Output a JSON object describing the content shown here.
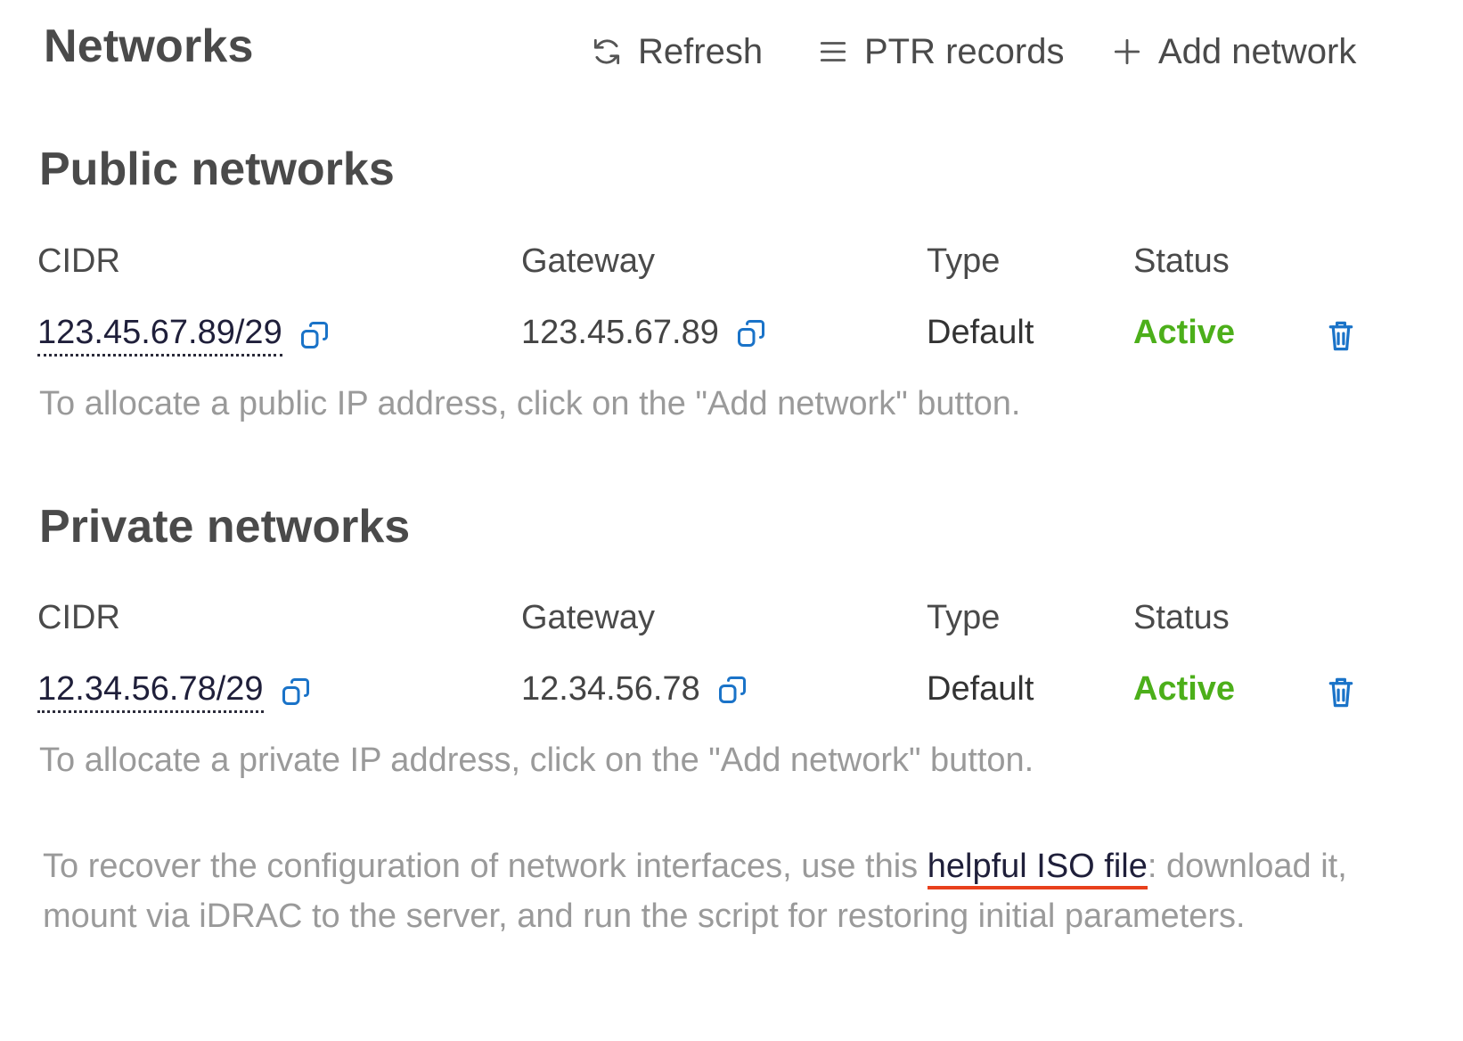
{
  "header": {
    "title": "Networks",
    "refresh_label": "Refresh",
    "ptr_label": "PTR records",
    "add_label": "Add network"
  },
  "columns": {
    "cidr": "CIDR",
    "gateway": "Gateway",
    "type": "Type",
    "status": "Status"
  },
  "public": {
    "title": "Public networks",
    "row": {
      "cidr": "123.45.67.89/29",
      "gateway": "123.45.67.89",
      "type": "Default",
      "status": "Active"
    },
    "hint": "To allocate a public IP address, click on the \"Add network\" button."
  },
  "private": {
    "title": "Private networks",
    "row": {
      "cidr": "12.34.56.78/29",
      "gateway": "12.34.56.78",
      "type": "Default",
      "status": "Active"
    },
    "hint": "To allocate a private IP address, click on the \"Add network\" button."
  },
  "footer": {
    "before": "To recover the configuration of network interfaces, use this ",
    "link": "helpful ISO file",
    "after": ": download it, mount via iDRAC to the server, and run the script for restoring initial parameters."
  },
  "colors": {
    "active": "#4caf1a",
    "icon_blue": "#1a73c8",
    "link_underline": "#e8401c"
  }
}
